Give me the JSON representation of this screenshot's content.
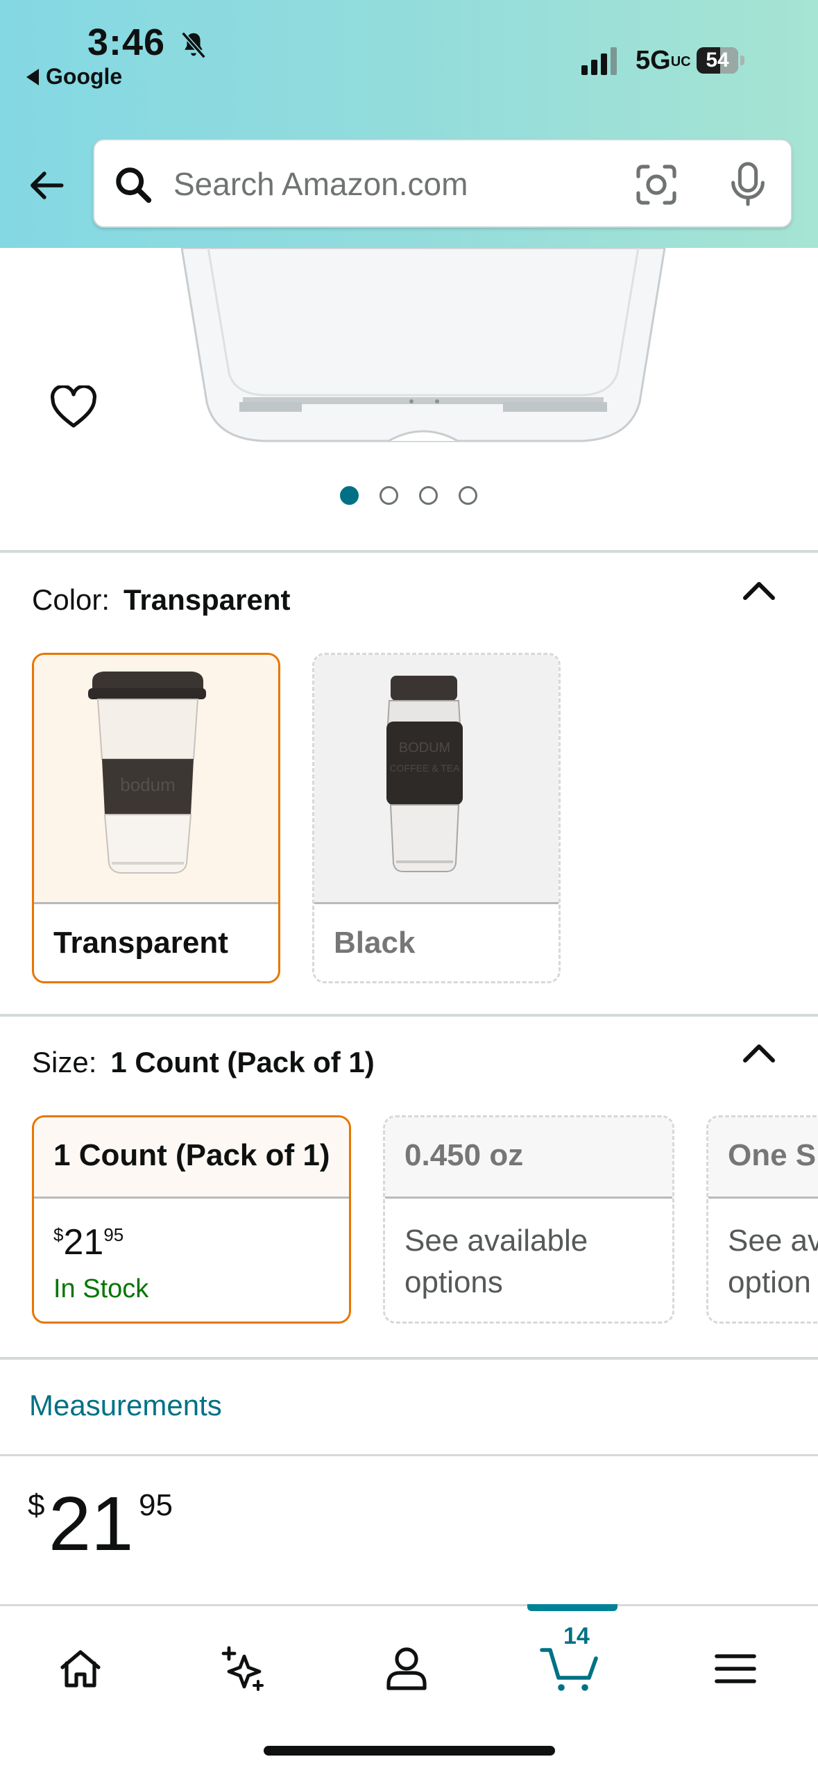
{
  "status_bar": {
    "time": "3:46",
    "back_app": "Google",
    "network": "5G",
    "network_suffix": "UC",
    "battery": "54"
  },
  "search": {
    "placeholder": "Search Amazon.com"
  },
  "carousel": {
    "pages": 4,
    "active_page": 1
  },
  "color_section": {
    "label": "Color:",
    "selected": "Transparent",
    "options": [
      {
        "label": "Transparent"
      },
      {
        "label": "Black"
      }
    ]
  },
  "size_section": {
    "label": "Size:",
    "selected": "1 Count (Pack of 1)",
    "options": [
      {
        "label": "1 Count (Pack of 1)",
        "price_symbol": "$",
        "price_whole": "21",
        "price_fraction": "95",
        "availability": "In Stock"
      },
      {
        "label": "0.450 oz",
        "note": "See available options"
      },
      {
        "label": "One Si",
        "note": "See av option"
      }
    ]
  },
  "measurements_link": "Measurements",
  "price": {
    "symbol": "$",
    "whole": "21",
    "fraction": "95"
  },
  "bottom_nav": {
    "items": [
      "home",
      "rufus",
      "account",
      "cart",
      "menu"
    ],
    "cart_count": "14",
    "active": "cart"
  },
  "colors": {
    "accent_teal": "#007185",
    "selected_border": "#e77600",
    "in_stock_green": "#007600"
  }
}
